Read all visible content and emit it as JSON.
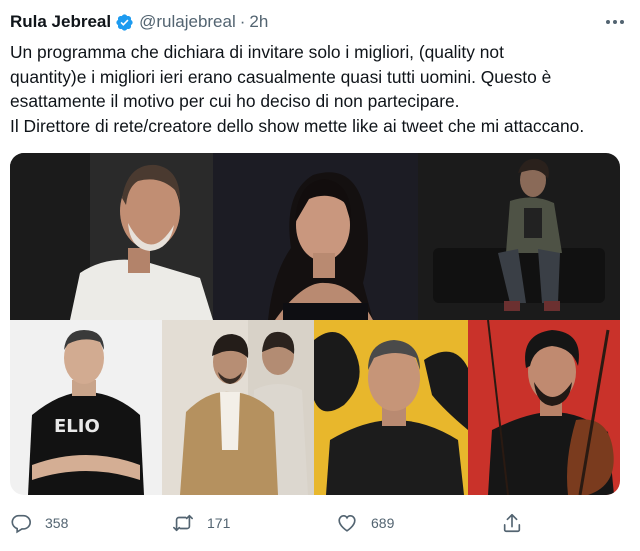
{
  "author": {
    "name": "Rula Jebreal",
    "handle": "@rulajebreal",
    "separator": "·",
    "time": "2h",
    "verified_color": "#1d9bf0"
  },
  "tweet": {
    "lines": [
      "Un programma che dichiara di invitare solo i migliori, (quality not",
      "quantity)e i migliori ieri erano casualmente quasi tutti uomini. Questo è",
      "esattamente il motivo per cui ho deciso di non partecipare.",
      "Il Direttore di rete/creatore dello show mette like ai tweet che mi attaccano."
    ]
  },
  "media": {
    "shirt_text": "ELIO"
  },
  "stats": {
    "replies": "358",
    "retweets": "171",
    "likes": "689"
  },
  "icons": {
    "more": "more-options-icon",
    "reply": "reply-icon",
    "retweet": "retweet-icon",
    "like": "heart-icon",
    "share": "share-icon"
  }
}
